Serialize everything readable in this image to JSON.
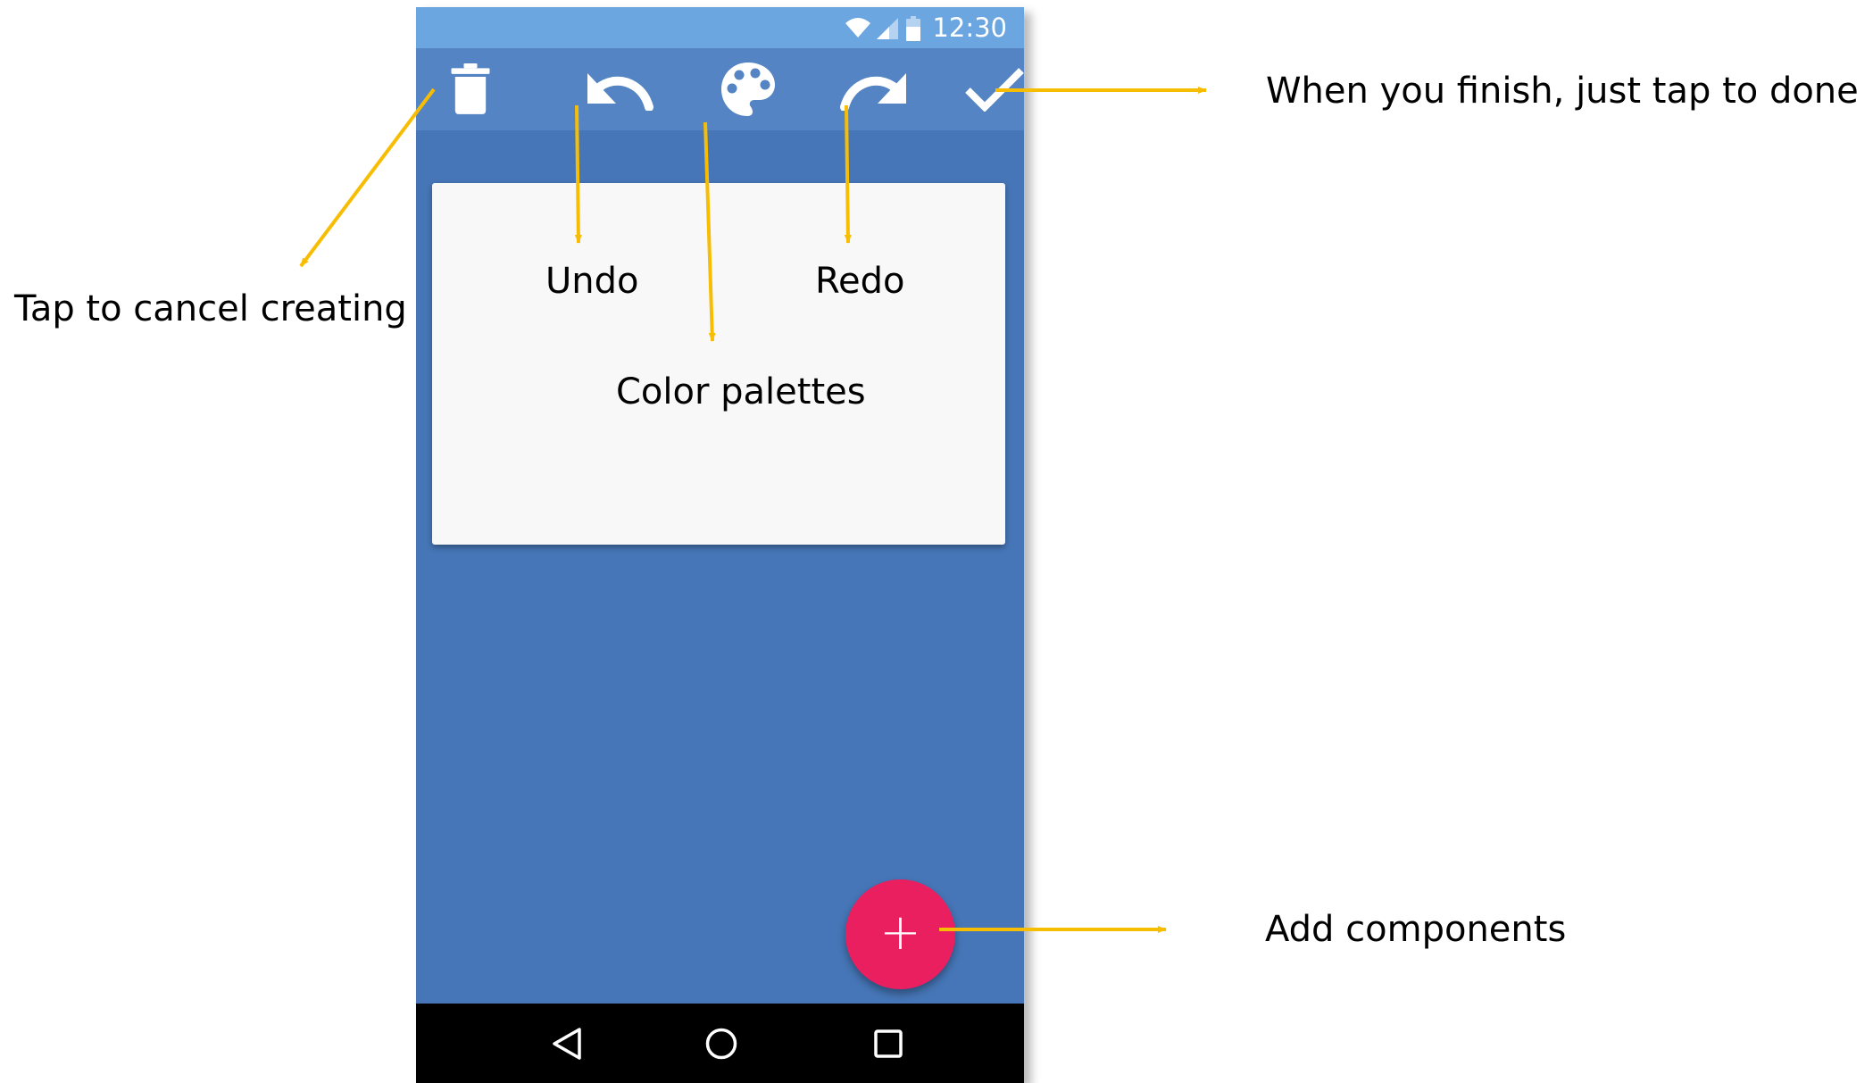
{
  "status_bar": {
    "time": "12:30",
    "icons": [
      "wifi-icon",
      "cell-signal-icon",
      "battery-icon"
    ]
  },
  "toolbar": {
    "buttons": [
      {
        "name": "delete-button",
        "icon": "trash-icon"
      },
      {
        "name": "undo-button",
        "icon": "undo-icon"
      },
      {
        "name": "color-palette-button",
        "icon": "palette-icon"
      },
      {
        "name": "redo-button",
        "icon": "redo-icon"
      },
      {
        "name": "done-button",
        "icon": "check-icon"
      }
    ]
  },
  "card": {
    "label_undo": "Undo",
    "label_redo": "Redo",
    "label_palettes": "Color palettes"
  },
  "fab": {
    "symbol": "+",
    "icon": "plus-icon"
  },
  "nav_bar": {
    "icons": [
      "back-icon",
      "home-icon",
      "recents-icon"
    ]
  },
  "annotations": {
    "cancel": "Tap to cancel creating",
    "done": "When you finish, just tap to done",
    "add": "Add components"
  },
  "colors": {
    "status_bar": "#6ba6e1",
    "toolbar": "#5484c3",
    "background": "#4676b7",
    "card": "#f8f8f8",
    "fab": "#e91f60",
    "arrow": "#f7bd02",
    "nav_bar": "#000000"
  }
}
